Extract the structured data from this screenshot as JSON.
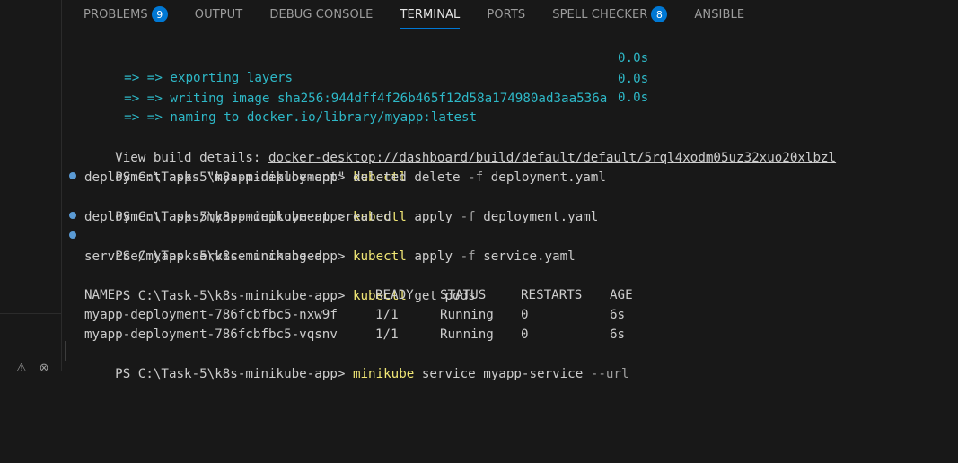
{
  "tabs": [
    {
      "label": "PROBLEMS",
      "badge": "9",
      "active": false
    },
    {
      "label": "OUTPUT",
      "badge": null,
      "active": false
    },
    {
      "label": "DEBUG CONSOLE",
      "badge": null,
      "active": false
    },
    {
      "label": "TERMINAL",
      "badge": null,
      "active": true
    },
    {
      "label": "PORTS",
      "badge": null,
      "active": false
    },
    {
      "label": "SPELL CHECKER",
      "badge": "8",
      "active": false
    },
    {
      "label": "ANSIBLE",
      "badge": null,
      "active": false
    }
  ],
  "build": {
    "exporting": {
      "text": "=> => exporting layers",
      "time": "0.0s"
    },
    "writing": {
      "text": "=> => writing image sha256:944dff4f26b465f12d58a174980ad3aa536a",
      "time": "0.0s"
    },
    "naming": {
      "text": "=> => naming to docker.io/library/myapp:latest",
      "time": "0.0s"
    },
    "details_label": "View build details: ",
    "details_url": "docker-desktop://dashboard/build/default/default/5rql4xodm05uz32xuo20xlbzl"
  },
  "prompt": "PS C:\\Task-5\\k8s-minikube-app> ",
  "commands": [
    {
      "cmd": "kubectl",
      "args": "delete",
      "flag": "-f",
      "rest": "deployment.yaml"
    },
    {
      "cmd": "kubectl",
      "args": "apply",
      "flag": "-f",
      "rest": "deployment.yaml"
    },
    {
      "cmd": "kubectl",
      "args": "apply",
      "flag": "-f",
      "rest": "service.yaml"
    },
    {
      "cmd": "kubectl",
      "args": "get pods",
      "flag": "",
      "rest": ""
    },
    {
      "cmd": "minikube",
      "args": "service myapp-service",
      "flag": "--url",
      "rest": ""
    }
  ],
  "outputs": {
    "deleted": "deployment.apps \"myapp-deployment\" deleted",
    "created": "deployment.apps/myapp-deployment created",
    "unchanged": "service/myapp-service unchanged"
  },
  "pods_table": {
    "headers": [
      "NAME",
      "READY",
      "STATUS",
      "RESTARTS",
      "AGE"
    ],
    "rows": [
      [
        "myapp-deployment-786fcbfbc5-nxw9f",
        "1/1",
        "Running",
        "0",
        "6s"
      ],
      [
        "myapp-deployment-786fcbfbc5-vqsnv",
        "1/1",
        "Running",
        "0",
        "6s"
      ]
    ]
  },
  "colors": {
    "accent": "#0078d4",
    "cyan": "#2eb8c7",
    "yellow": "#f0e675",
    "dot": "#5b9bd5"
  }
}
